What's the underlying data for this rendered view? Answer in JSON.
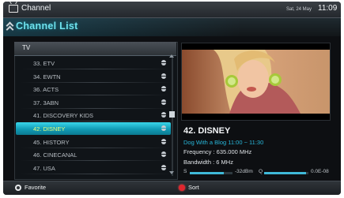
{
  "topbar": {
    "title": "Channel",
    "date": "Sat, 24 May",
    "time": "11:09"
  },
  "header": {
    "title": "Channel List"
  },
  "list": {
    "group": "TV",
    "channels": [
      {
        "label": "33. ETV"
      },
      {
        "label": "34. EWTN"
      },
      {
        "label": "36. ACTS"
      },
      {
        "label": "37. 3ABN"
      },
      {
        "label": "41. DISCOVERY KIDS"
      },
      {
        "label": "42. DISNEY"
      },
      {
        "label": "45. HISTORY"
      },
      {
        "label": "46. CINECANAL"
      },
      {
        "label": "47. USA"
      }
    ],
    "selected_index": 5
  },
  "details": {
    "channel": "42. DISNEY",
    "program": "Dog With a Blog 11:00 ~ 11:30",
    "frequency": "Frequency : 635.000 MHz",
    "bandwidth": "Bandwidth : 6 MHz"
  },
  "signal": {
    "strength_label": "S",
    "strength_value": "-32dBm",
    "strength_level": 0.8,
    "quality_label": "Q",
    "quality_value": "0.0E-08",
    "quality_level": 0.95
  },
  "footer": {
    "favorite_label": "Favorite",
    "sort_label": "Sort"
  },
  "colors": {
    "accent": "#1ab3cc",
    "selected_text": "#eaff7a",
    "program_text": "#28b6d9",
    "sort_button": "#e0262e"
  }
}
